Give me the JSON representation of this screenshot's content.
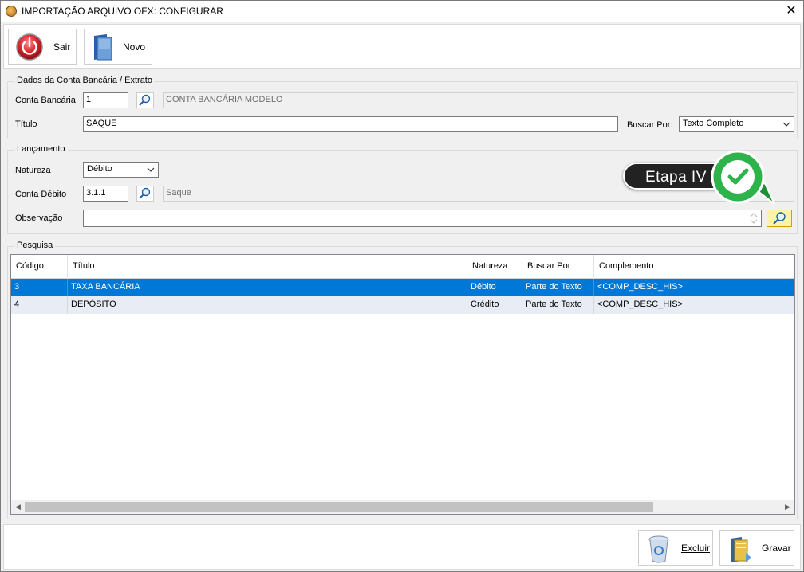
{
  "window": {
    "title": "IMPORTAÇÃO ARQUIVO OFX: CONFIGURAR",
    "close_glyph": "✕"
  },
  "toolbar": {
    "sair_label": "Sair",
    "novo_label": "Novo"
  },
  "dados": {
    "group_title": "Dados da Conta Bancária / Extrato",
    "conta_label": "Conta Bancária",
    "conta_value": "1",
    "conta_desc": "CONTA BANCÁRIA MODELO",
    "titulo_label": "Título",
    "titulo_value": "SAQUE",
    "buscar_label": "Buscar Por:",
    "buscar_value": "Texto Completo"
  },
  "lancamento": {
    "group_title": "Lançamento",
    "natureza_label": "Natureza",
    "natureza_value": "Débito",
    "conta_debito_label": "Conta Débito",
    "conta_debito_value": "3.1.1",
    "conta_debito_desc": "Saque",
    "observacao_label": "Observação",
    "observacao_value": ""
  },
  "overlay": {
    "label": "Etapa IV",
    "colors": {
      "green": "#2db34a",
      "dark": "#222222"
    }
  },
  "pesquisa": {
    "group_title": "Pesquisa",
    "columns": [
      "Código",
      "Título",
      "Natureza",
      "Buscar Por",
      "Complemento"
    ],
    "rows": [
      [
        "3",
        "TAXA BANCÁRIA",
        "Débito",
        "Parte do Texto",
        "<COMP_DESC_HIS>"
      ],
      [
        "4",
        "DEPÓSITO",
        "Crédito",
        "Parte do Texto",
        "<COMP_DESC_HIS>"
      ]
    ],
    "selected_row": 0
  },
  "footer": {
    "excluir_label": "Excluir",
    "gravar_label": "Gravar"
  },
  "colors": {
    "selection": "#0078d7",
    "alt_row": "#e8ecf5",
    "accent_red": "#d7262b"
  }
}
